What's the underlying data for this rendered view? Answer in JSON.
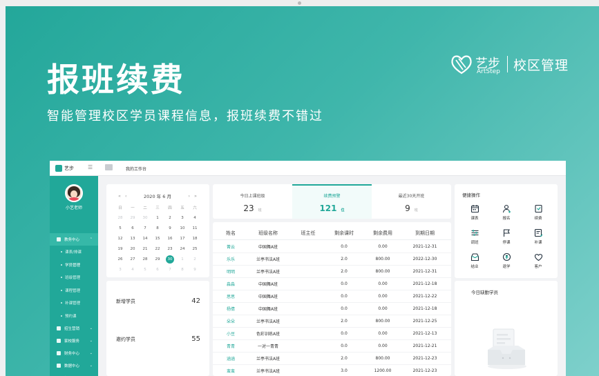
{
  "hero": {
    "title": "报班续费",
    "subtitle": "智能管理校区学员课程信息，报班续费不错过"
  },
  "brand": {
    "name_cn": "艺步",
    "name_en": "ArtStep",
    "product": "校区管理"
  },
  "app": {
    "name": "艺步",
    "breadcrumb": "我的工作台",
    "teacher_name": "小艺老师",
    "menu": [
      {
        "label": "教务中心",
        "type": "group",
        "active": true
      },
      {
        "label": "课表/排课",
        "type": "sub"
      },
      {
        "label": "学员管理",
        "type": "sub",
        "current": true
      },
      {
        "label": "班级管理",
        "type": "sub"
      },
      {
        "label": "课程管理",
        "type": "sub"
      },
      {
        "label": "补课管理",
        "type": "sub"
      },
      {
        "label": "预约课",
        "type": "sub"
      },
      {
        "label": "招生营销",
        "type": "group"
      },
      {
        "label": "家校服务",
        "type": "group"
      },
      {
        "label": "财务中心",
        "type": "group"
      },
      {
        "label": "数据中心",
        "type": "group"
      },
      {
        "label": "机构中心",
        "type": "group"
      }
    ],
    "calendar": {
      "year": "2020",
      "year_unit": "年",
      "month": "6",
      "month_unit": "月",
      "nav_prev_year": "«",
      "nav_prev_month": "‹",
      "nav_next_month": "›",
      "nav_next_year": "»",
      "weekdays": [
        "日",
        "一",
        "二",
        "三",
        "四",
        "五",
        "六"
      ],
      "days": [
        {
          "d": "28",
          "m": true
        },
        {
          "d": "29",
          "m": true
        },
        {
          "d": "30",
          "m": true
        },
        {
          "d": "1"
        },
        {
          "d": "2"
        },
        {
          "d": "3"
        },
        {
          "d": "4"
        },
        {
          "d": "5"
        },
        {
          "d": "6"
        },
        {
          "d": "7"
        },
        {
          "d": "8"
        },
        {
          "d": "9"
        },
        {
          "d": "10"
        },
        {
          "d": "11"
        },
        {
          "d": "12"
        },
        {
          "d": "13"
        },
        {
          "d": "14"
        },
        {
          "d": "15"
        },
        {
          "d": "16"
        },
        {
          "d": "17"
        },
        {
          "d": "18"
        },
        {
          "d": "19"
        },
        {
          "d": "20"
        },
        {
          "d": "21"
        },
        {
          "d": "22"
        },
        {
          "d": "23"
        },
        {
          "d": "24"
        },
        {
          "d": "25"
        },
        {
          "d": "26"
        },
        {
          "d": "27"
        },
        {
          "d": "28"
        },
        {
          "d": "29"
        },
        {
          "d": "30",
          "sel": true
        },
        {
          "d": "1",
          "m": true
        },
        {
          "d": "2",
          "m": true
        },
        {
          "d": "3",
          "m": true
        },
        {
          "d": "4",
          "m": true
        },
        {
          "d": "5",
          "m": true
        },
        {
          "d": "6",
          "m": true
        },
        {
          "d": "7",
          "m": true
        },
        {
          "d": "8",
          "m": true
        },
        {
          "d": "9",
          "m": true
        }
      ]
    },
    "stats": [
      {
        "label": "新增学员",
        "value": "42"
      },
      {
        "label": "邀约学员",
        "value": "55"
      }
    ],
    "tabs": [
      {
        "label": "今日上课班级",
        "value": "23",
        "unit": "班"
      },
      {
        "label": "续费预警",
        "value": "121",
        "unit": "位",
        "active": true
      },
      {
        "label": "最近30天开班",
        "value": "9",
        "unit": "班"
      }
    ],
    "table": {
      "columns": [
        "姓名",
        "班级名称",
        "班主任",
        "剩余课时",
        "剩余费用",
        "到期日期"
      ],
      "rows": [
        [
          "菁云",
          "中国舞A班",
          "",
          "0.0",
          "0.00",
          "2021-12-31"
        ],
        [
          "乐乐",
          "兰亭书法A班",
          "",
          "2.0",
          "800.00",
          "2022-12-30"
        ],
        [
          "明明",
          "兰亭书法A班",
          "",
          "2.0",
          "800.00",
          "2021-12-31"
        ],
        [
          "淼淼",
          "中国舞A班",
          "",
          "0.0",
          "0.00",
          "2021-12-18"
        ],
        [
          "思思",
          "中国舞A班",
          "",
          "0.0",
          "0.00",
          "2021-12-22"
        ],
        [
          "杨倩",
          "中国舞A班",
          "",
          "0.0",
          "0.00",
          "2021-12-18"
        ],
        [
          "朵朵",
          "兰亭书法A班",
          "",
          "2.0",
          "800.00",
          "2021-12-25"
        ],
        [
          "小豆",
          "色彩训练A班",
          "",
          "0.0",
          "0.00",
          "2021-12-13"
        ],
        [
          "青青",
          "一对一青青",
          "",
          "0.0",
          "0.00",
          "2021-12-21"
        ],
        [
          "涵涵",
          "兰亭书法A班",
          "",
          "2.0",
          "800.00",
          "2021-12-23"
        ],
        [
          "蛮蛮",
          "兰亭书法A班",
          "",
          "3.0",
          "1200.00",
          "2021-12-23"
        ]
      ]
    },
    "quick": {
      "title": "便捷操作",
      "items": [
        {
          "label": "课表",
          "icon": "calendar-icon"
        },
        {
          "label": "报名",
          "icon": "user-add-icon"
        },
        {
          "label": "续费",
          "icon": "renew-icon"
        },
        {
          "label": "调班",
          "icon": "sliders-icon"
        },
        {
          "label": "停课",
          "icon": "flag-icon"
        },
        {
          "label": "补课",
          "icon": "edit-list-icon"
        },
        {
          "label": "结业",
          "icon": "inbox-icon"
        },
        {
          "label": "退学",
          "icon": "refund-icon"
        },
        {
          "label": "客户",
          "icon": "heart-icon"
        }
      ]
    },
    "absent": {
      "title": "今日缺勤学员"
    }
  },
  "colors": {
    "accent": "#21a899",
    "hero_start": "#23a79a",
    "hero_end": "#7ed0cb"
  }
}
